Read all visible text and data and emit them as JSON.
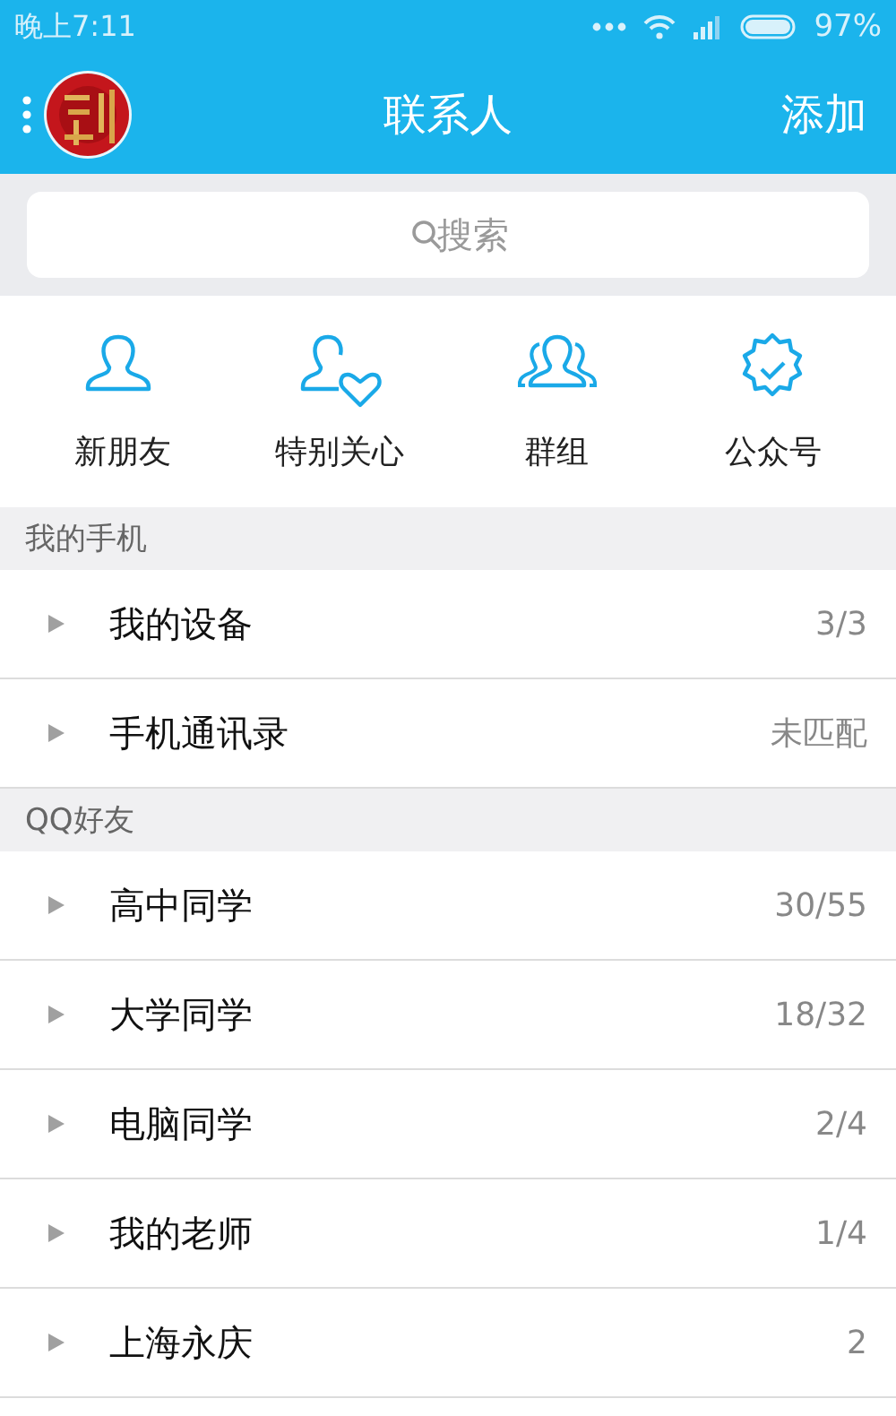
{
  "status_bar": {
    "time": "晚上7:11",
    "battery": "97%"
  },
  "header": {
    "title": "联系人",
    "action": "添加"
  },
  "search": {
    "placeholder": "搜索"
  },
  "shortcuts": [
    {
      "label": "新朋友",
      "kind": "person"
    },
    {
      "label": "特别关心",
      "kind": "heart"
    },
    {
      "label": "群组",
      "kind": "group"
    },
    {
      "label": "公众号",
      "kind": "badge"
    }
  ],
  "sections": [
    {
      "title": "我的手机",
      "groups": [
        {
          "name": "我的设备",
          "count": "3/3",
          "expanded": false
        },
        {
          "name": "手机通讯录",
          "count": "未匹配",
          "expanded": false
        }
      ]
    },
    {
      "title": "QQ好友",
      "groups": [
        {
          "name": "高中同学",
          "count": "30/55",
          "expanded": false
        },
        {
          "name": "大学同学",
          "count": "18/32",
          "expanded": false
        },
        {
          "name": "电脑同学",
          "count": "2/4",
          "expanded": false
        },
        {
          "name": "我的老师",
          "count": "1/4",
          "expanded": false
        },
        {
          "name": "上海永庆",
          "count": "2",
          "expanded": false
        }
      ]
    }
  ]
}
